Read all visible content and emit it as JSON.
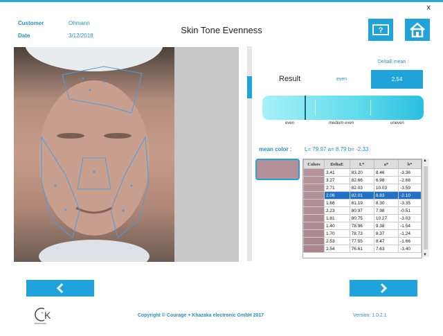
{
  "header": {
    "customer_label": "Customer",
    "customer_value": "Ohmann",
    "date_label": "Date",
    "date_value": "3/12/2018",
    "title": "Skin Tone Evenness",
    "close": "x",
    "help_icon": "help-question-icon",
    "home_icon": "home-icon"
  },
  "result": {
    "label": "Result",
    "status": "even",
    "deltae_mean_label": "DeltaE  mean :",
    "deltae_mean_value": "2.54",
    "scale": [
      "even",
      "medium even",
      "uneven"
    ],
    "marker_fraction": 0.26
  },
  "mean_color": {
    "label": "mean color :",
    "values": "L= 79.97 a= 8.79 b= -2.33",
    "swatch_hex": "#b49098"
  },
  "table": {
    "headers": [
      "Colors",
      "DeltaE",
      "L*",
      "a*",
      "b*"
    ],
    "rows": [
      {
        "hex": "#b6959a",
        "deltae": "3.41",
        "l": "83.20",
        "a": "8.46",
        "b": "-3.36"
      },
      {
        "hex": "#b4939a",
        "deltae": "3.27",
        "l": "82.66",
        "a": "6.98",
        "b": "-2.68"
      },
      {
        "hex": "#b39199",
        "deltae": "2.71",
        "l": "82.03",
        "a": "10.03",
        "b": "-3.59"
      },
      {
        "hex": "#b29097",
        "deltae": "2.06",
        "l": "82.01",
        "a": "8.83",
        "b": "-2.10"
      },
      {
        "hex": "#b18f96",
        "deltae": "1.66",
        "l": "81.19",
        "a": "8.30",
        "b": "-3.35"
      },
      {
        "hex": "#b08e96",
        "deltae": "2.23",
        "l": "80.97",
        "a": "7.98",
        "b": "-0.51"
      },
      {
        "hex": "#af8d95",
        "deltae": "1.81",
        "l": "80.75",
        "a": "10.27",
        "b": "-3.03"
      },
      {
        "hex": "#ae8b93",
        "deltae": "1.40",
        "l": "78.96",
        "a": "9.38",
        "b": "-1.54"
      },
      {
        "hex": "#ad8a92",
        "deltae": "1.70",
        "l": "78.73",
        "a": "8.37",
        "b": "-1.24"
      },
      {
        "hex": "#ab8890",
        "deltae": "2.53",
        "l": "77.55",
        "a": "8.47",
        "b": "-1.66"
      },
      {
        "hex": "#aa878f",
        "deltae": "2.54",
        "l": "76.61",
        "a": "7.63",
        "b": "-3.40"
      }
    ],
    "selected_index": 3
  },
  "footer": {
    "prev_icon": "chevron-left-icon",
    "next_icon": "chevron-right-icon",
    "copyright": "Copyright © Courage + Khazaka electronic GmbH 2017",
    "version": "Version: 1.0.2.1",
    "logo_text": "electronic"
  },
  "colors": {
    "accent": "#1fa3da",
    "label": "#2a8fc2",
    "selected_row": "#1e73c8"
  }
}
